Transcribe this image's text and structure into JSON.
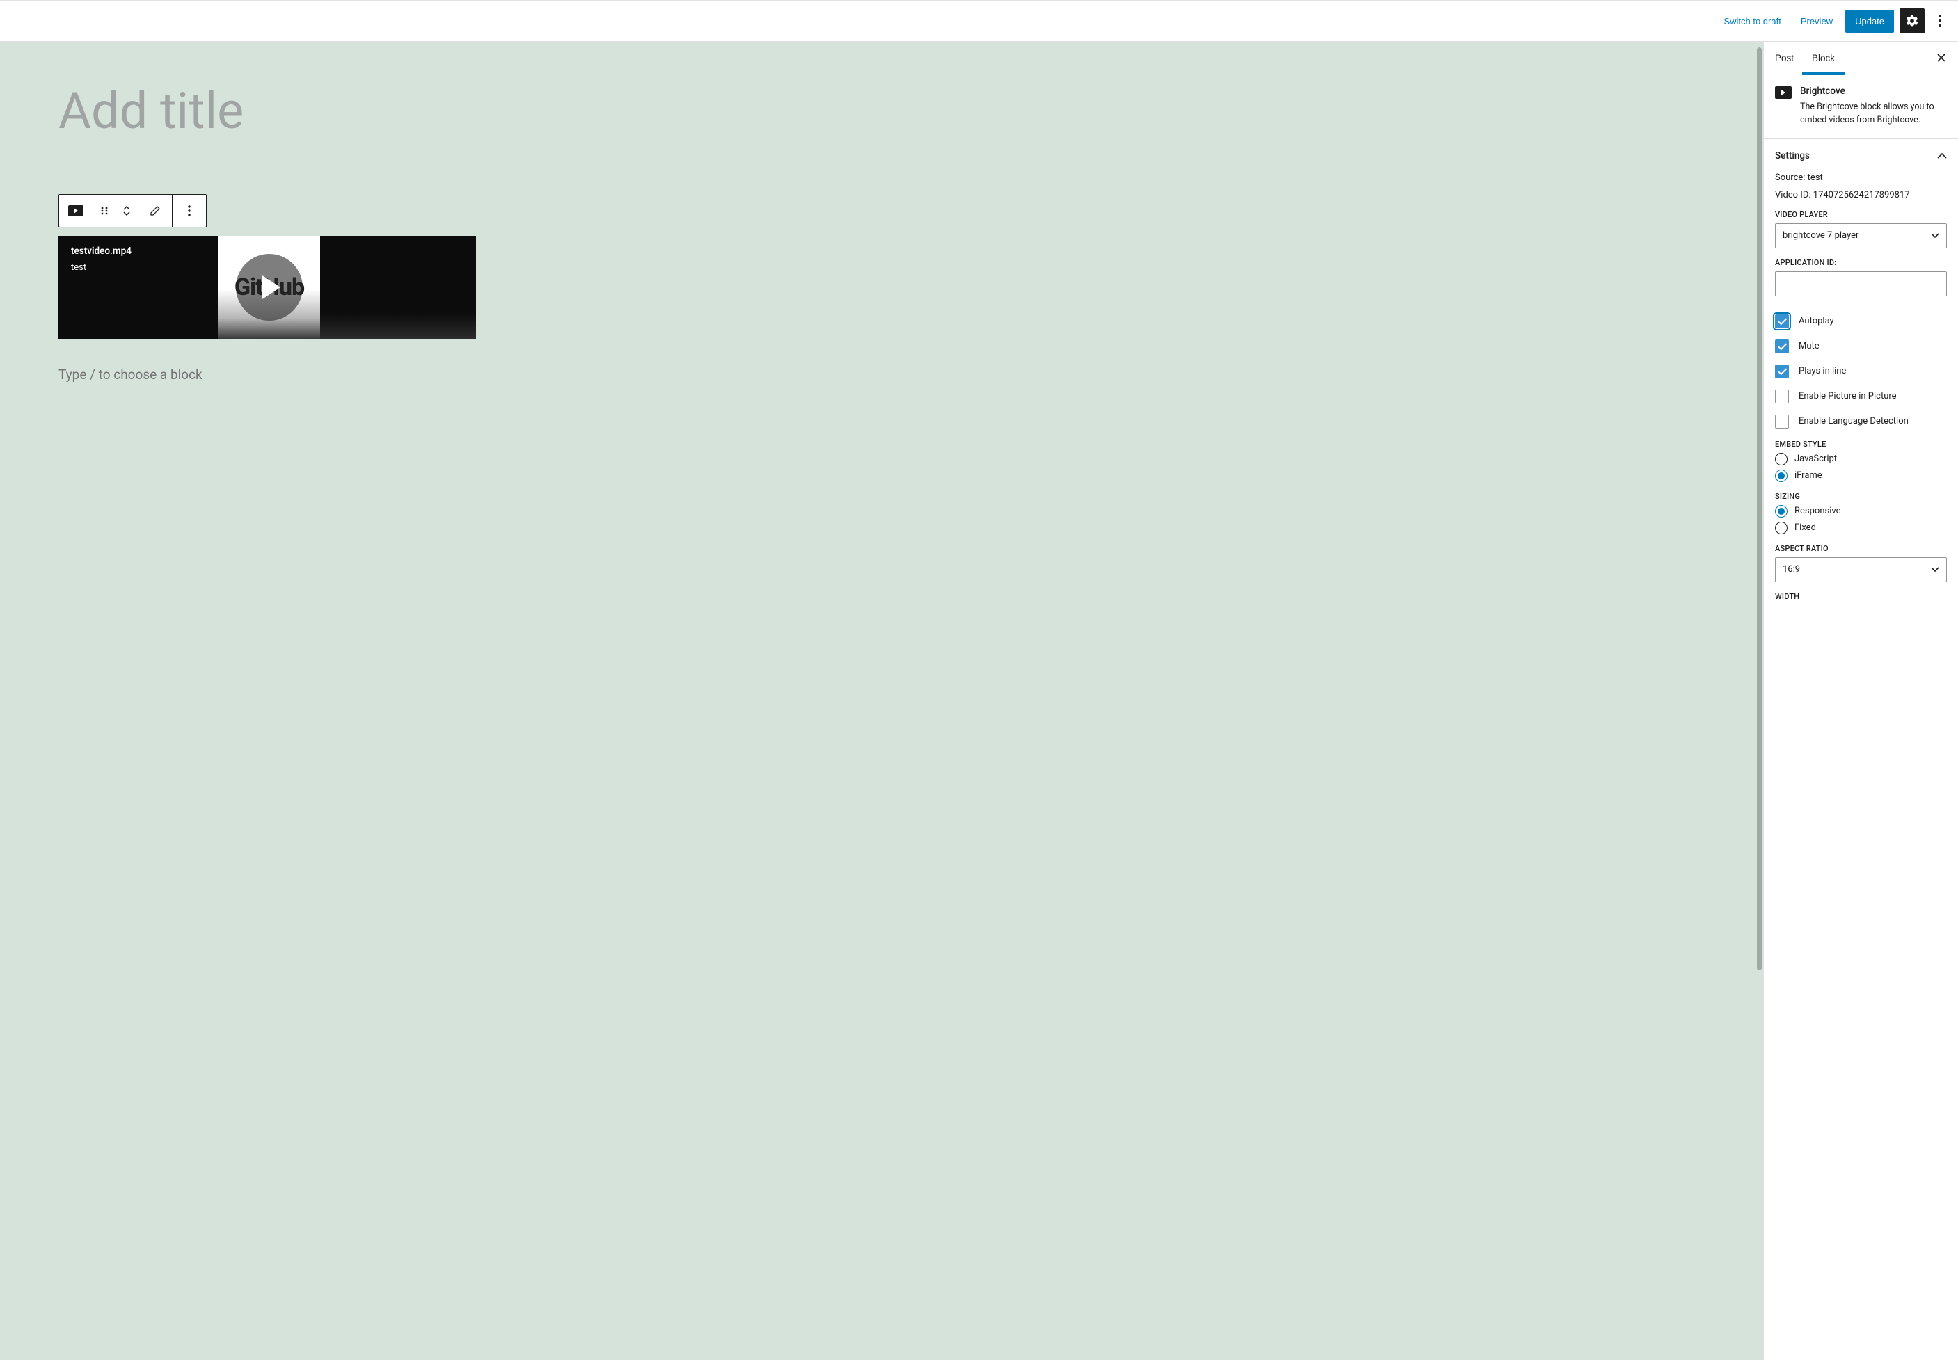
{
  "topbar": {
    "switch_draft": "Switch to draft",
    "preview": "Preview",
    "update": "Update"
  },
  "editor": {
    "title_placeholder": "Add title",
    "choose_block_hint": "Type / to choose a block",
    "video": {
      "filename": "testvideo.mp4",
      "source_label": "test",
      "center_word": "GitHub"
    }
  },
  "sidebar": {
    "tabs": {
      "post": "Post",
      "block": "Block"
    },
    "block": {
      "name": "Brightcove",
      "description": "The Brightcove block allows you to embed videos from Brightcove."
    },
    "settings": {
      "panel_title": "Settings",
      "source_label": "Source:",
      "source_value": "test",
      "video_id_label": "Video ID:",
      "video_id_value": "1740725624217899817",
      "video_player_label": "VIDEO PLAYER",
      "video_player_value": "brightcove 7 player",
      "app_id_label": "APPLICATION ID:",
      "app_id_value": "",
      "autoplay": "Autoplay",
      "mute": "Mute",
      "plays_inline": "Plays in line",
      "pip": "Enable Picture in Picture",
      "lang_detect": "Enable Language Detection",
      "embed_style_label": "EMBED STYLE",
      "embed_js": "JavaScript",
      "embed_iframe": "iFrame",
      "sizing_label": "SIZING",
      "sizing_responsive": "Responsive",
      "sizing_fixed": "Fixed",
      "aspect_ratio_label": "ASPECT RATIO",
      "aspect_ratio_value": "16:9",
      "width_label": "WIDTH"
    }
  }
}
